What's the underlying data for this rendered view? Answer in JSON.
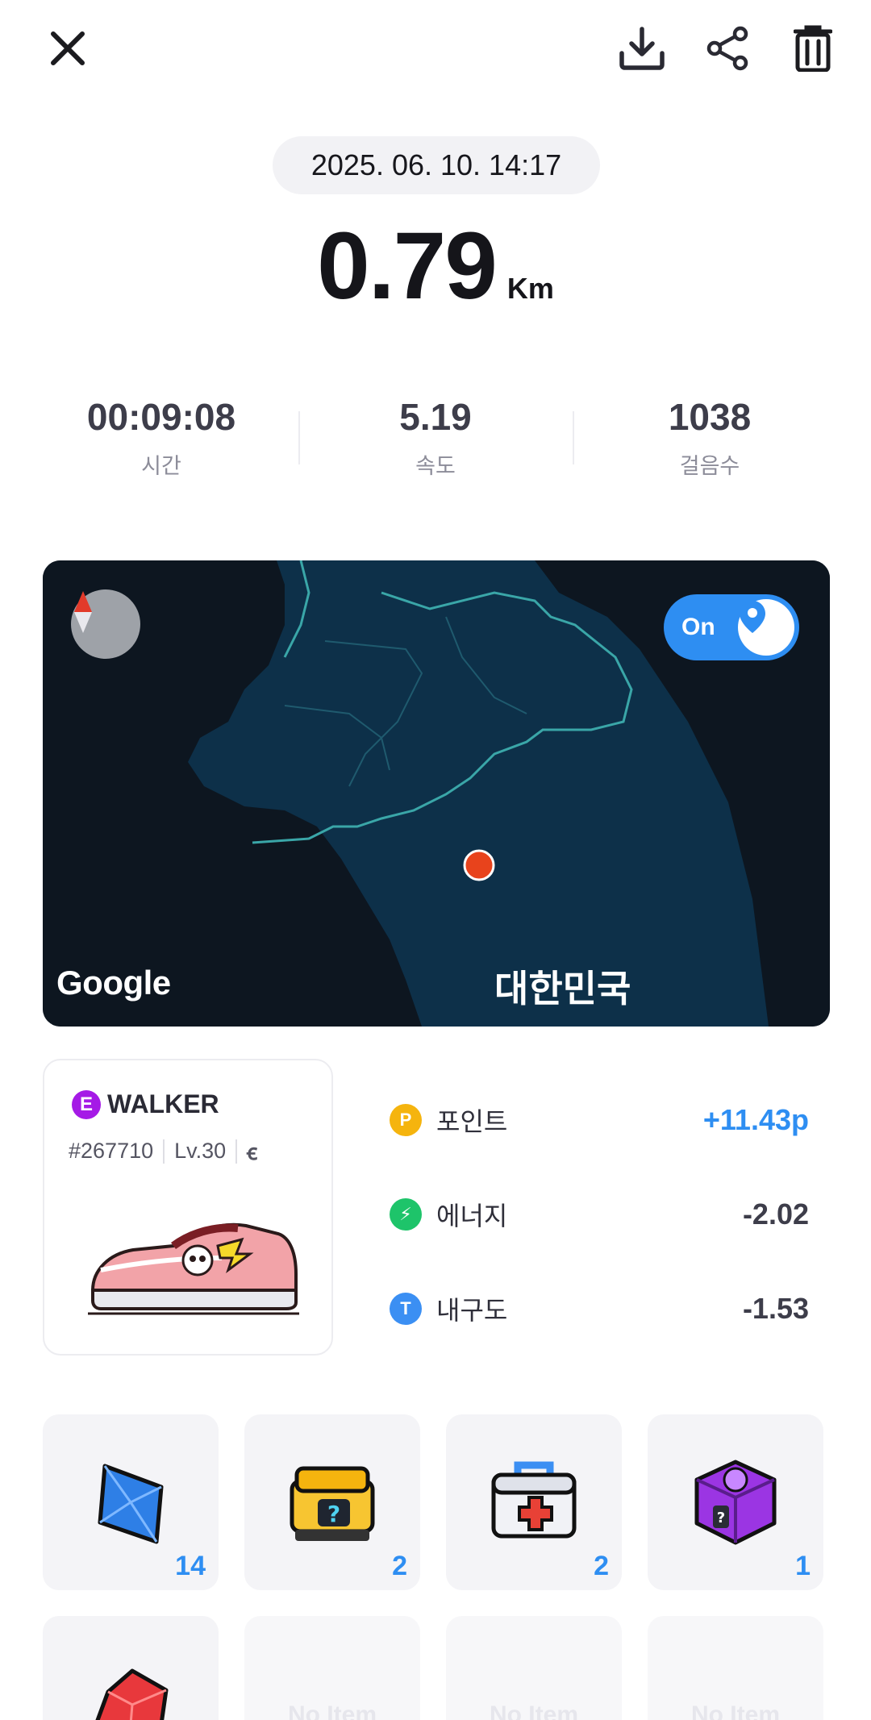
{
  "header": {
    "close_icon": "close-icon",
    "download_icon": "download-icon",
    "share_icon": "share-icon",
    "delete_icon": "trash-icon"
  },
  "record": {
    "datetime": "2025. 06. 10. 14:17",
    "distance": "0.79",
    "distance_unit": "Km"
  },
  "stats": [
    {
      "value": "00:09:08",
      "label": "시간"
    },
    {
      "value": "5.19",
      "label": "속도"
    },
    {
      "value": "1038",
      "label": "걸음수"
    }
  ],
  "map": {
    "toggle_label": "On",
    "attribution": "Google",
    "country_label": "대한민국",
    "colors": {
      "land": "#0d3049",
      "sea": "#0d1620",
      "border": "#3aa6a8",
      "marker": "#e8431c"
    }
  },
  "shoe": {
    "grade": "E",
    "type": "WALKER",
    "id": "#267710",
    "level": "Lv.30",
    "attr_symbol": "ꞓ",
    "colors": {
      "grade": "#a51ae6"
    }
  },
  "rewards": [
    {
      "icon": "point-icon",
      "icon_text": "P",
      "name": "포인트",
      "amount": "+11.43p",
      "color": "#f5b40e",
      "positive": true
    },
    {
      "icon": "energy-icon",
      "icon_text": "⚡",
      "name": "에너지",
      "amount": "-2.02",
      "color": "#1ec46a",
      "positive": false
    },
    {
      "icon": "durability-icon",
      "icon_text": "T",
      "name": "내구도",
      "amount": "-1.53",
      "color": "#3b8ff3",
      "positive": false
    }
  ],
  "items": [
    {
      "icon": "blue-gem-icon",
      "count": "14"
    },
    {
      "icon": "yellow-mystery-box-icon",
      "count": "2"
    },
    {
      "icon": "repair-kit-icon",
      "count": "2"
    },
    {
      "icon": "purple-mystery-box-icon",
      "count": "1"
    },
    {
      "icon": "red-gem-icon",
      "count": ""
    },
    {
      "empty_label": "No Item"
    },
    {
      "empty_label": "No Item"
    },
    {
      "empty_label": "No Item"
    }
  ]
}
